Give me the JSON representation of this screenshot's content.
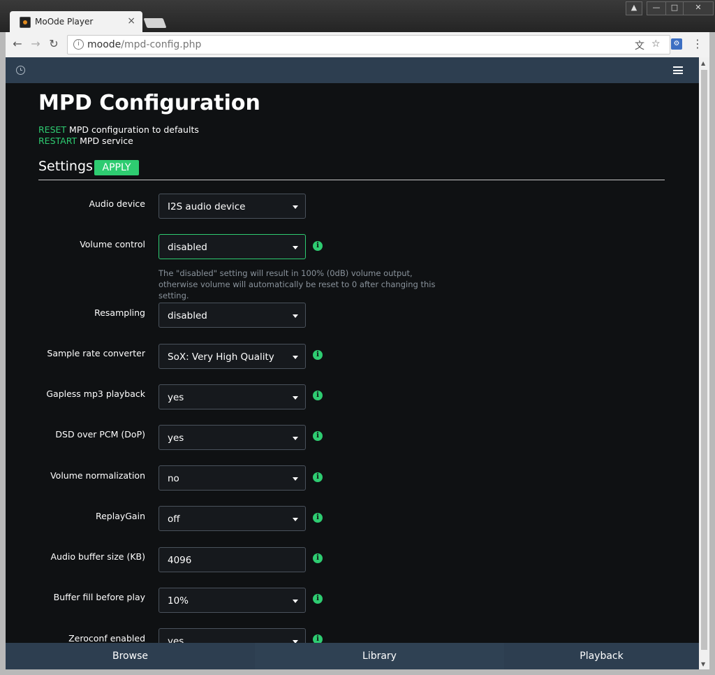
{
  "browser": {
    "tab_title": "MoOde Player",
    "tab_close": "×",
    "url_host": "moode",
    "url_path": "/mpd-config.php",
    "window_controls": [
      "—",
      "□",
      "✕"
    ],
    "info_glyph": "i",
    "icons": [
      "back-icon",
      "forward-icon",
      "reload-icon",
      "translate-icon",
      "star-icon",
      "extension-icon",
      "kebab-menu-icon"
    ]
  },
  "header": {
    "icons": [
      "clock-icon",
      "hamburger-menu-icon"
    ]
  },
  "page": {
    "title": "MPD Configuration",
    "reset_link": "RESET",
    "reset_text": " MPD configuration to defaults",
    "restart_link": "RESTART",
    "restart_text": " MPD service",
    "settings_heading": "Settings",
    "apply_label": "APPLY",
    "volume_help": "The \"disabled\" setting will result in 100% (0dB) volume output, otherwise volume will automatically be reset to 0 after changing this setting."
  },
  "settings": [
    {
      "label": "Audio device",
      "value": "I2S audio device",
      "type": "select",
      "info": false
    },
    {
      "label": "Volume control",
      "value": "disabled",
      "type": "select",
      "info": true
    },
    {
      "label": "Resampling",
      "value": "disabled",
      "type": "select",
      "info": false
    },
    {
      "label": "Sample rate converter",
      "value": "SoX: Very High Quality",
      "type": "select",
      "info": true
    },
    {
      "label": "Gapless mp3 playback",
      "value": "yes",
      "type": "select",
      "info": true
    },
    {
      "label": "DSD over PCM (DoP)",
      "value": "yes",
      "type": "select",
      "info": true
    },
    {
      "label": "Volume normalization",
      "value": "no",
      "type": "select",
      "info": true
    },
    {
      "label": "ReplayGain",
      "value": "off",
      "type": "select",
      "info": true
    },
    {
      "label": "Audio buffer size (KB)",
      "value": "4096",
      "type": "input",
      "info": true
    },
    {
      "label": "Buffer fill before play",
      "value": "10%",
      "type": "select",
      "info": true
    },
    {
      "label": "Zeroconf enabled",
      "value": "yes",
      "type": "select",
      "info": true
    }
  ],
  "bottom_nav": {
    "browse": "Browse",
    "library": "Library",
    "playback": "Playback"
  },
  "colors": {
    "accent": "#2ecc71",
    "header": "#2d3e50",
    "background": "#0f1113"
  }
}
